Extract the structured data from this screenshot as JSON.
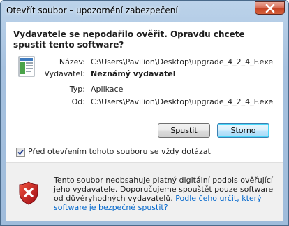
{
  "window": {
    "title": "Otevřít soubor – upozornění zabezpečení"
  },
  "dialog": {
    "heading": "Vydavatele se nepodařilo ověřit. Opravdu chcete spustit tento software?",
    "fields": [
      {
        "label": "Název:",
        "value": "C:\\Users\\Pavilion\\Desktop\\upgrade_4_2_4_F.exe"
      },
      {
        "label": "Vydavatel:",
        "value": "Neznámý vydavatel"
      },
      {
        "label": "Typ:",
        "value": "Aplikace"
      },
      {
        "label": "Od:",
        "value": "C:\\Users\\Pavilion\\Desktop\\upgrade_4_2_4_F.exe"
      }
    ],
    "buttons": {
      "run": "Spustit",
      "cancel": "Storno"
    },
    "checkbox": {
      "label": "Před otevřením tohoto souboru se vždy dotázat",
      "checked": true
    },
    "footer": {
      "text": "Tento soubor neobsahuje platný digitální podpis ověřující jeho vydavatele. Doporučujeme spouštět pouze software od důvěryhodných vydavatelů. ",
      "link": "Podle čeho určit, který software je bezpečné spustit?"
    }
  },
  "icons": {
    "close": "close-icon",
    "file": "application-file-icon",
    "shield": "security-shield-icon",
    "check": "checkmark-icon"
  },
  "colors": {
    "link": "#0066cc",
    "close_button": "#c44123",
    "shield_red": "#c8102e"
  }
}
